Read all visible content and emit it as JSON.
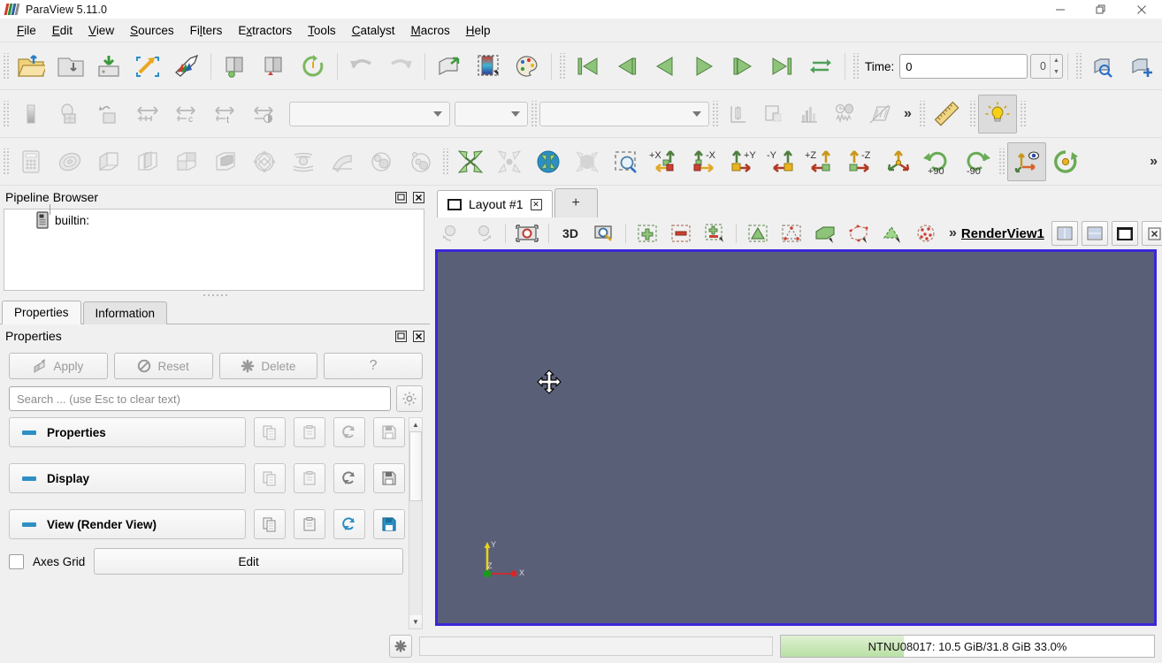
{
  "window": {
    "title": "ParaView 5.11.0",
    "minimize": "—",
    "maximize": "❐",
    "close": "✕"
  },
  "menubar": {
    "items": [
      {
        "label": "File",
        "mnemonic": "F"
      },
      {
        "label": "Edit",
        "mnemonic": "E"
      },
      {
        "label": "View",
        "mnemonic": "V"
      },
      {
        "label": "Sources",
        "mnemonic": "S"
      },
      {
        "label": "Filters",
        "mnemonic": "l"
      },
      {
        "label": "Extractors",
        "mnemonic": "x"
      },
      {
        "label": "Tools",
        "mnemonic": "T"
      },
      {
        "label": "Catalyst",
        "mnemonic": "C"
      },
      {
        "label": "Macros",
        "mnemonic": "M"
      },
      {
        "label": "Help",
        "mnemonic": "H"
      }
    ]
  },
  "main_toolbar": {
    "file_icons": [
      "open-file-icon",
      "save-state-icon",
      "save-data-icon",
      "connect-icon",
      "disconnect-icon"
    ],
    "server_icons": [
      "connect-server-icon",
      "disconnect-server-icon",
      "reset-session-icon"
    ],
    "edit_icons": [
      "undo-icon",
      "redo-icon"
    ],
    "camera_icons": [
      "camera-undo-icon",
      "color-map-icon",
      "edit-color-legend-icon"
    ],
    "vcr": {
      "first_frame": "first-frame-icon",
      "previous_frame": "previous-frame-icon",
      "play_reverse": "play-reverse-icon",
      "play": "play-icon",
      "next_frame": "next-frame-icon",
      "last_frame": "last-frame-icon",
      "loop": "loop-icon"
    },
    "time_label": "Time:",
    "time_value": "0",
    "time_index": "0",
    "capture_icons": [
      "find-data-icon",
      "add-camera-icon"
    ]
  },
  "representation_toolbar": {
    "icons": [
      "scalar-bar-icon",
      "rescale-data-icon",
      "rescale-custom-icon",
      "rescale-visible-icon",
      "rescale-temporal-icon",
      "rescale-over-time-icon",
      "rescale-data-over-time-icon"
    ],
    "array_combo": "",
    "component_combo": "",
    "representation_combo": "",
    "plot_icons": [
      "plot-over-line-icon",
      "plot-selection-icon",
      "histogram-icon",
      "plot-data-over-time-icon",
      "plot-on-intersection-icon"
    ],
    "overflow": "»",
    "ruler_icon": "ruler-icon",
    "light_kit_icon": "light-bulb-icon",
    "light_kit_active": true
  },
  "filters_toolbar": {
    "filter_icons": [
      "calculator-icon",
      "contour-icon",
      "clip-icon",
      "slice-icon",
      "threshold-icon",
      "extract-subset-icon",
      "glyph-icon",
      "stream-tracer-icon",
      "warp-by-vector-icon",
      "group-datasets-icon",
      "extract-level-icon"
    ],
    "camera_icons": [
      "reset-camera-icon",
      "zoom-to-data-icon",
      "zoom-closest-icon",
      "zoom-to-box-icon"
    ],
    "axis_buttons": [
      "+X",
      "-X",
      "+Y",
      "-Y",
      "+Z",
      "-Z"
    ],
    "isometric_icon": "isometric-view-icon",
    "rotate_plus_label": "+90",
    "rotate_minus_label": "-90",
    "show_axes_icon": "show-orientation-axes-icon",
    "show_axes_active": true,
    "center_rotation_icon": "center-of-rotation-icon",
    "overflow": "»"
  },
  "pipeline_browser": {
    "title": "Pipeline Browser",
    "float_icon": "undock-icon",
    "close_icon": "close-icon",
    "nodes": [
      {
        "label": "builtin:",
        "icon": "server-icon"
      }
    ]
  },
  "properties_panel": {
    "tabs": [
      {
        "label": "Properties",
        "selected": true
      },
      {
        "label": "Information",
        "selected": false
      }
    ],
    "title": "Properties",
    "float_icon": "undock-icon",
    "close_icon": "close-icon",
    "buttons": [
      {
        "label": "Apply",
        "icon": "apply-icon",
        "enabled": false
      },
      {
        "label": "Reset",
        "icon": "reset-icon",
        "enabled": false
      },
      {
        "label": "Delete",
        "icon": "delete-icon",
        "enabled": false
      },
      {
        "label": "?",
        "icon": "help-icon",
        "enabled": false
      }
    ],
    "search_placeholder": "Search ... (use Esc to clear text)",
    "search_value": "",
    "gear_icon": "gear-icon",
    "sections": [
      {
        "label": "Properties",
        "actions_enabled": false
      },
      {
        "label": "Display",
        "actions_enabled": false
      },
      {
        "label": "View (Render View)",
        "actions_enabled": true
      }
    ],
    "section_action_icons": [
      "copy-icon",
      "paste-icon",
      "restore-defaults-icon",
      "save-as-defaults-icon"
    ],
    "axes_grid": {
      "label": "Axes Grid",
      "checked": false,
      "edit_label": "Edit"
    },
    "accent_color": "#2f8fc4",
    "scrollbar": {
      "up": "▲",
      "down": "▼"
    }
  },
  "layout": {
    "tabs": [
      {
        "label": "Layout #1",
        "icon": "layout-icon",
        "closable": true,
        "selected": true
      }
    ],
    "add_tab_label": "+"
  },
  "view_toolbar": {
    "icons": [
      "interactive-select-cell-icon",
      "interactive-select-point-icon",
      "select-cells-icon",
      "mode-3d-label",
      "zoom-select-icon",
      "add-selection-icon",
      "subtract-selection-icon",
      "toggle-selection-icon",
      "select-cells-through-icon",
      "select-points-through-icon",
      "select-block-icon",
      "select-frustum-cell-icon",
      "select-frustum-point-icon",
      "select-points-polygon-icon"
    ],
    "mode_3d_label": "3D",
    "overflow": "»",
    "view_name": "RenderView1",
    "split_horizontal_icon": "split-horizontal-icon",
    "split_vertical_icon": "split-vertical-icon",
    "maximize_icon": "maximize-view-icon",
    "close_icon": "close-view-icon"
  },
  "render_view": {
    "background_color": "#5a5f78",
    "border_color": "#3a27d8",
    "axes": {
      "x_label": "X",
      "y_label": "Y",
      "z_label": "Z",
      "x_color": "#d62728",
      "y_color": "#e8d21a",
      "z_color": "#1a9a1a"
    },
    "cursor": "move-cursor"
  },
  "statusbar": {
    "cancel_icon": "cancel-icon",
    "progress_value": "",
    "memory_text": "NTNU08017: 10.5 GiB/31.8 GiB 33.0%",
    "memory_percent": 33.0,
    "memory_fill_color": "#b9e0a4"
  }
}
